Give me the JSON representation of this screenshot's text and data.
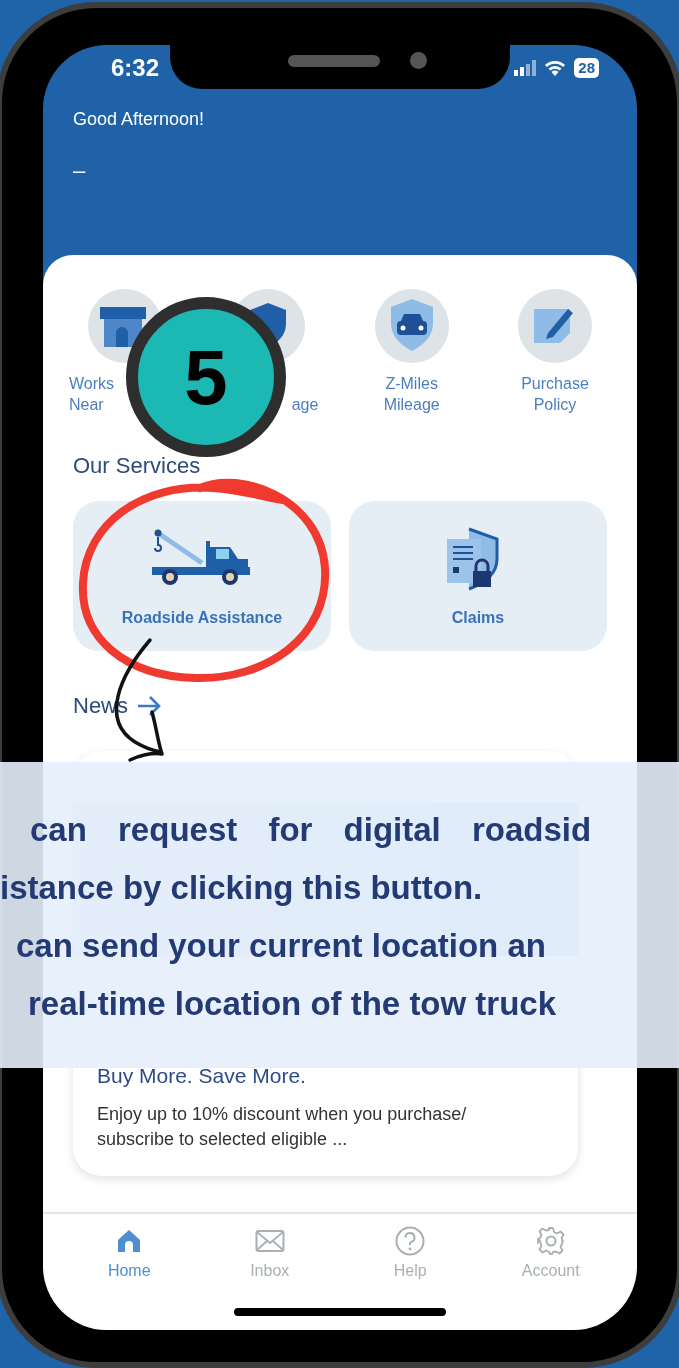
{
  "status_bar": {
    "time": "6:32",
    "battery": "28"
  },
  "header": {
    "greeting": "Good Afternoon!",
    "name": "–"
  },
  "quick_actions": [
    {
      "kind": "workshop",
      "lines": [
        "Works",
        "Near"
      ]
    },
    {
      "kind": "coverage",
      "lines": [
        "age"
      ]
    },
    {
      "kind": "car-shield",
      "lines": [
        "Z-Miles",
        "Mileage"
      ]
    },
    {
      "kind": "policy",
      "lines": [
        "Purchase",
        "Policy"
      ]
    }
  ],
  "services_title": "Our Services",
  "services": [
    {
      "kind": "tow-truck",
      "label": "Roadside Assistance"
    },
    {
      "kind": "claims",
      "label": "Claims"
    }
  ],
  "news": {
    "title": "News",
    "card": {
      "title": "Buy More. Save More.",
      "text": "Enjoy up to 10% discount when you purchase/ subscribe to selected eligible ..."
    }
  },
  "tab_bar": [
    {
      "kind": "home",
      "label": "Home",
      "selected": true
    },
    {
      "kind": "inbox",
      "label": "Inbox",
      "selected": false
    },
    {
      "kind": "help",
      "label": "Help",
      "selected": false
    },
    {
      "kind": "account",
      "label": "Account",
      "selected": false
    }
  ],
  "annotation": {
    "step": "5",
    "caption_lines": [
      "can request for digital roadsid",
      "istance by clicking this button.",
      "can send your current location an",
      "real-time location of the tow truck"
    ]
  }
}
